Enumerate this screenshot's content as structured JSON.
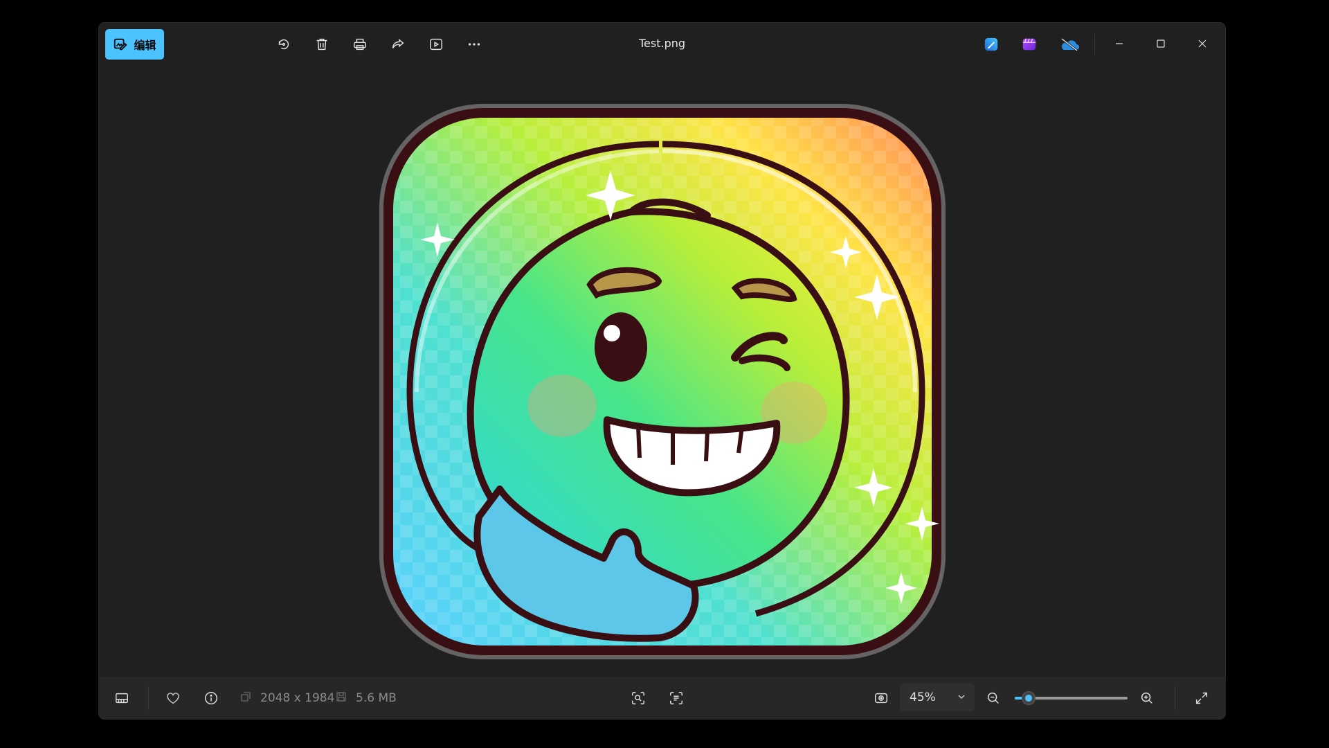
{
  "window": {
    "title": "Test.png"
  },
  "toolbar": {
    "edit_label": "编辑"
  },
  "image_info": {
    "dimensions": "2048 x 1984",
    "file_size": "5.6 MB"
  },
  "zoom": {
    "level_label": "45%",
    "level": 0.45,
    "slider_fraction": 0.12
  },
  "icons": {
    "edit": "edit-image-icon",
    "rotate": "rotate-icon",
    "delete": "trash-icon",
    "print": "printer-icon",
    "share": "share-icon",
    "slideshow": "slideshow-icon",
    "more": "more-icon",
    "designer": "designer-app-icon",
    "clipchamp": "clipchamp-app-icon",
    "onedrive": "onedrive-icon"
  },
  "colors": {
    "accent": "#4cc2ff",
    "window_bg": "#202020",
    "bottombar_bg": "#272727"
  }
}
